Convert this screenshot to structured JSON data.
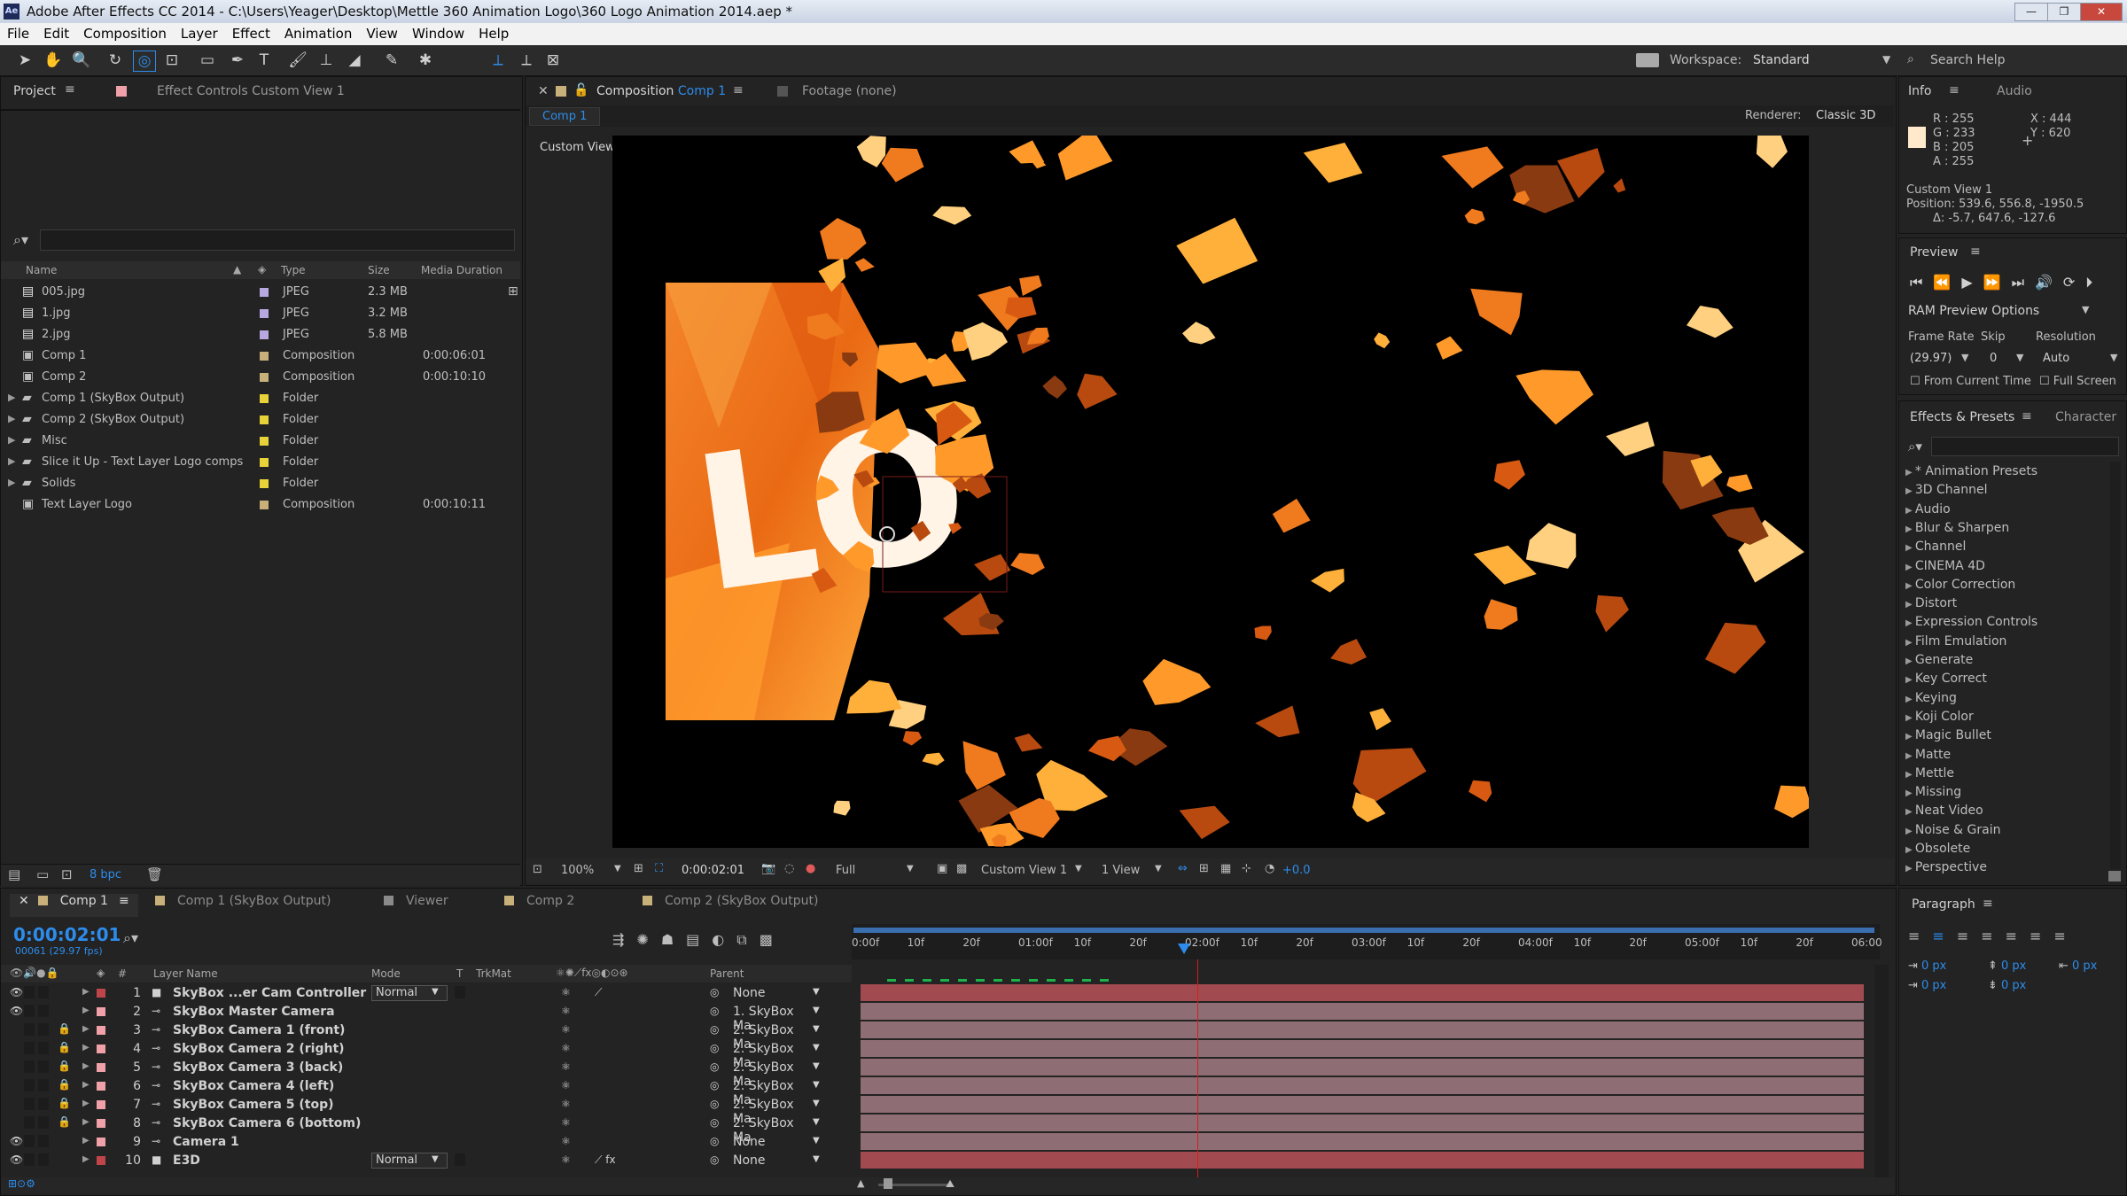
{
  "title_bar": {
    "app_badge": "Ae",
    "title": "Adobe After Effects CC 2014 - C:\\Users\\Yeager\\Desktop\\Mettle 360 Animation Logo\\360 Logo Animation 2014.aep *",
    "minimize": "—",
    "maximize": "❐",
    "close": "✕"
  },
  "menu": [
    "File",
    "Edit",
    "Composition",
    "Layer",
    "Effect",
    "Animation",
    "View",
    "Window",
    "Help"
  ],
  "toolbar": {
    "workspace_label": "Workspace:",
    "workspace_value": "Standard",
    "search_help": "Search Help"
  },
  "project_panel": {
    "tab_project": "Project",
    "tab_effect_controls": "Effect Controls",
    "effect_controls_target": "Custom View 1",
    "columns": {
      "name": "Name",
      "type": "Type",
      "size": "Size",
      "duration": "Media Duration"
    },
    "items": [
      {
        "name": "005.jpg",
        "type": "JPEG",
        "size": "2.3 MB",
        "duration": "",
        "icon": "image-file-icon",
        "color": "#b8a8e0"
      },
      {
        "name": "1.jpg",
        "type": "JPEG",
        "size": "3.2 MB",
        "duration": "",
        "icon": "image-file-icon",
        "color": "#b8a8e0"
      },
      {
        "name": "2.jpg",
        "type": "JPEG",
        "size": "5.8 MB",
        "duration": "",
        "icon": "image-file-icon",
        "color": "#b8a8e0"
      },
      {
        "name": "Comp 1",
        "type": "Composition",
        "size": "",
        "duration": "0:00:06:01",
        "icon": "composition-icon",
        "color": "#c7b07a"
      },
      {
        "name": "Comp 2",
        "type": "Composition",
        "size": "",
        "duration": "0:00:10:10",
        "icon": "composition-icon",
        "color": "#c7b07a"
      },
      {
        "name": "Comp 1 (SkyBox Output)",
        "type": "Folder",
        "size": "",
        "duration": "",
        "icon": "folder-icon",
        "color": "#e8d23a"
      },
      {
        "name": "Comp 2 (SkyBox Output)",
        "type": "Folder",
        "size": "",
        "duration": "",
        "icon": "folder-icon",
        "color": "#e8d23a"
      },
      {
        "name": "Misc",
        "type": "Folder",
        "size": "",
        "duration": "",
        "icon": "folder-icon",
        "color": "#e8d23a"
      },
      {
        "name": "Slice it Up - Text Layer Logo comps",
        "type": "Folder",
        "size": "",
        "duration": "",
        "icon": "folder-icon",
        "color": "#e8d23a"
      },
      {
        "name": "Solids",
        "type": "Folder",
        "size": "",
        "duration": "",
        "icon": "folder-icon",
        "color": "#e8d23a"
      },
      {
        "name": "Text Layer Logo",
        "type": "Composition",
        "size": "",
        "duration": "0:00:10:11",
        "icon": "composition-icon",
        "color": "#c7b07a"
      }
    ],
    "bpc": "8 bpc"
  },
  "comp_viewer": {
    "tab_label": "Composition",
    "tab_comp": "Comp 1",
    "footage_tab": "Footage (none)",
    "breadcrumb": "Comp 1",
    "renderer_label": "Renderer:",
    "renderer_value": "Classic 3D",
    "view_name": "Custom View 1",
    "zoom": "100%",
    "timecode": "0:00:02:01",
    "resolution": "Full",
    "view_dropdown": "Custom View 1",
    "view_count": "1 View",
    "exposure": "+0.0"
  },
  "info_panel": {
    "tab_info": "Info",
    "tab_audio": "Audio",
    "r": "R : 255",
    "g": "G : 233",
    "b": "B : 205",
    "a": "A : 255",
    "x": "X : 444",
    "y": "Y : 620",
    "swatch_color": "#ffe9cd",
    "view": "Custom View 1",
    "position": "Position: 539.6, 556.8, -1950.5",
    "delta": "Δ: -5.7, 647.6, -127.6"
  },
  "preview_panel": {
    "title": "Preview",
    "ram_options": "RAM Preview Options",
    "frame_rate_label": "Frame Rate",
    "skip_label": "Skip",
    "resolution_label": "Resolution",
    "frame_rate": "(29.97)",
    "skip": "0",
    "resolution": "Auto",
    "from_current": "From Current Time",
    "full_screen": "Full Screen"
  },
  "effects_panel": {
    "tab_effects": "Effects & Presets",
    "tab_character": "Character",
    "items": [
      "* Animation Presets",
      "3D Channel",
      "Audio",
      "Blur & Sharpen",
      "Channel",
      "CINEMA 4D",
      "Color Correction",
      "Distort",
      "Expression Controls",
      "Film Emulation",
      "Generate",
      "Key Correct",
      "Keying",
      "Koji Color",
      "Magic Bullet",
      "Matte",
      "Mettle",
      "Missing",
      "Neat Video",
      "Noise & Grain",
      "Obsolete",
      "Perspective"
    ]
  },
  "timeline": {
    "tabs": [
      "Comp 1",
      "Comp 1 (SkyBox Output)",
      "Viewer",
      "Comp 2",
      "Comp 2 (SkyBox Output)"
    ],
    "timecode": "0:00:02:01",
    "frame_info": "00061 (29.97 fps)",
    "columns": {
      "num": "#",
      "layer_name": "Layer Name",
      "mode": "Mode",
      "t": "T",
      "trkmat": "TrkMat",
      "parent": "Parent"
    },
    "ruler": [
      "0:00f",
      "10f",
      "20f",
      "01:00f",
      "10f",
      "20f",
      "02:00f",
      "10f",
      "20f",
      "03:00f",
      "10f",
      "20f",
      "04:00f",
      "10f",
      "20f",
      "05:00f",
      "10f",
      "20f",
      "06:00"
    ],
    "layers": [
      {
        "num": "1",
        "name": "SkyBox ...er Cam Controller",
        "mode": "Normal",
        "parent": "None",
        "label_color": "#c0454a",
        "bar_color": "#a14a4f",
        "eye": "1",
        "lock": "",
        "icon": "solid-layer-icon"
      },
      {
        "num": "2",
        "name": "SkyBox Master Camera",
        "mode": "",
        "parent": "1. SkyBox Ma",
        "label_color": "#f0a0a8",
        "bar_color": "#8e6e74",
        "eye": "1",
        "lock": "",
        "icon": "camera-layer-icon"
      },
      {
        "num": "3",
        "name": "SkyBox Camera 1 (front)",
        "mode": "",
        "parent": "2. SkyBox Ma",
        "label_color": "#f0a0a8",
        "bar_color": "#8e6e74",
        "eye": "",
        "lock": "1",
        "icon": "camera-layer-icon"
      },
      {
        "num": "4",
        "name": "SkyBox Camera 2 (right)",
        "mode": "",
        "parent": "2. SkyBox Ma",
        "label_color": "#f0a0a8",
        "bar_color": "#8e6e74",
        "eye": "",
        "lock": "1",
        "icon": "camera-layer-icon"
      },
      {
        "num": "5",
        "name": "SkyBox Camera 3 (back)",
        "mode": "",
        "parent": "2. SkyBox Ma",
        "label_color": "#f0a0a8",
        "bar_color": "#8e6e74",
        "eye": "",
        "lock": "1",
        "icon": "camera-layer-icon"
      },
      {
        "num": "6",
        "name": "SkyBox Camera 4 (left)",
        "mode": "",
        "parent": "2. SkyBox Ma",
        "label_color": "#f0a0a8",
        "bar_color": "#8e6e74",
        "eye": "",
        "lock": "1",
        "icon": "camera-layer-icon"
      },
      {
        "num": "7",
        "name": "SkyBox Camera 5 (top)",
        "mode": "",
        "parent": "2. SkyBox Ma",
        "label_color": "#f0a0a8",
        "bar_color": "#8e6e74",
        "eye": "",
        "lock": "1",
        "icon": "camera-layer-icon"
      },
      {
        "num": "8",
        "name": "SkyBox Camera 6 (bottom)",
        "mode": "",
        "parent": "2. SkyBox Ma",
        "label_color": "#f0a0a8",
        "bar_color": "#8e6e74",
        "eye": "",
        "lock": "1",
        "icon": "camera-layer-icon"
      },
      {
        "num": "9",
        "name": "Camera 1",
        "mode": "",
        "parent": "None",
        "label_color": "#f0a0a8",
        "bar_color": "#8e6e74",
        "eye": "1",
        "lock": "",
        "icon": "camera-layer-icon"
      },
      {
        "num": "10",
        "name": "E3D",
        "mode": "Normal",
        "parent": "None",
        "label_color": "#c0454a",
        "bar_color": "#a14a4f",
        "eye": "1",
        "lock": "",
        "icon": "solid-layer-icon"
      }
    ]
  },
  "paragraph_panel": {
    "title": "Paragraph",
    "indent_values": [
      "0 px",
      "0 px",
      "0 px",
      "0 px",
      "0 px"
    ]
  },
  "colors": {
    "accent_blue": "#2d8ceb",
    "playhead": "#d22020",
    "work_area": "#1fb24a",
    "viewer_bg": "#000000"
  }
}
